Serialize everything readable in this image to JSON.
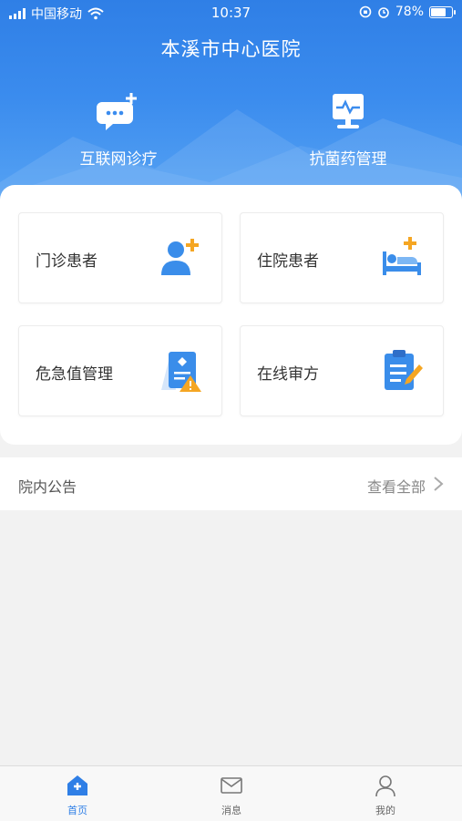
{
  "status_bar": {
    "carrier": "中国移动",
    "time": "10:37",
    "battery_text": "78%",
    "battery_level": 0.78
  },
  "header": {
    "title": "本溪市中心医院",
    "shortcuts": [
      {
        "label": "互联网诊疗",
        "icon": "chat-plus-icon"
      },
      {
        "label": "抗菌药管理",
        "icon": "monitor-pulse-icon"
      }
    ]
  },
  "tiles": [
    {
      "label": "门诊患者",
      "icon": "outpatient-user-icon"
    },
    {
      "label": "住院患者",
      "icon": "inpatient-bed-icon"
    },
    {
      "label": "危急值管理",
      "icon": "critical-value-warning-icon"
    },
    {
      "label": "在线审方",
      "icon": "clipboard-edit-icon"
    }
  ],
  "notice": {
    "title": "院内公告",
    "more_label": "查看全部"
  },
  "tabbar": {
    "items": [
      {
        "label": "首页",
        "icon": "home-icon",
        "active": true
      },
      {
        "label": "消息",
        "icon": "mail-icon",
        "active": false
      },
      {
        "label": "我的",
        "icon": "profile-icon",
        "active": false
      }
    ]
  },
  "colors": {
    "primary": "#2f7fe6",
    "accent_orange": "#f5a623"
  }
}
